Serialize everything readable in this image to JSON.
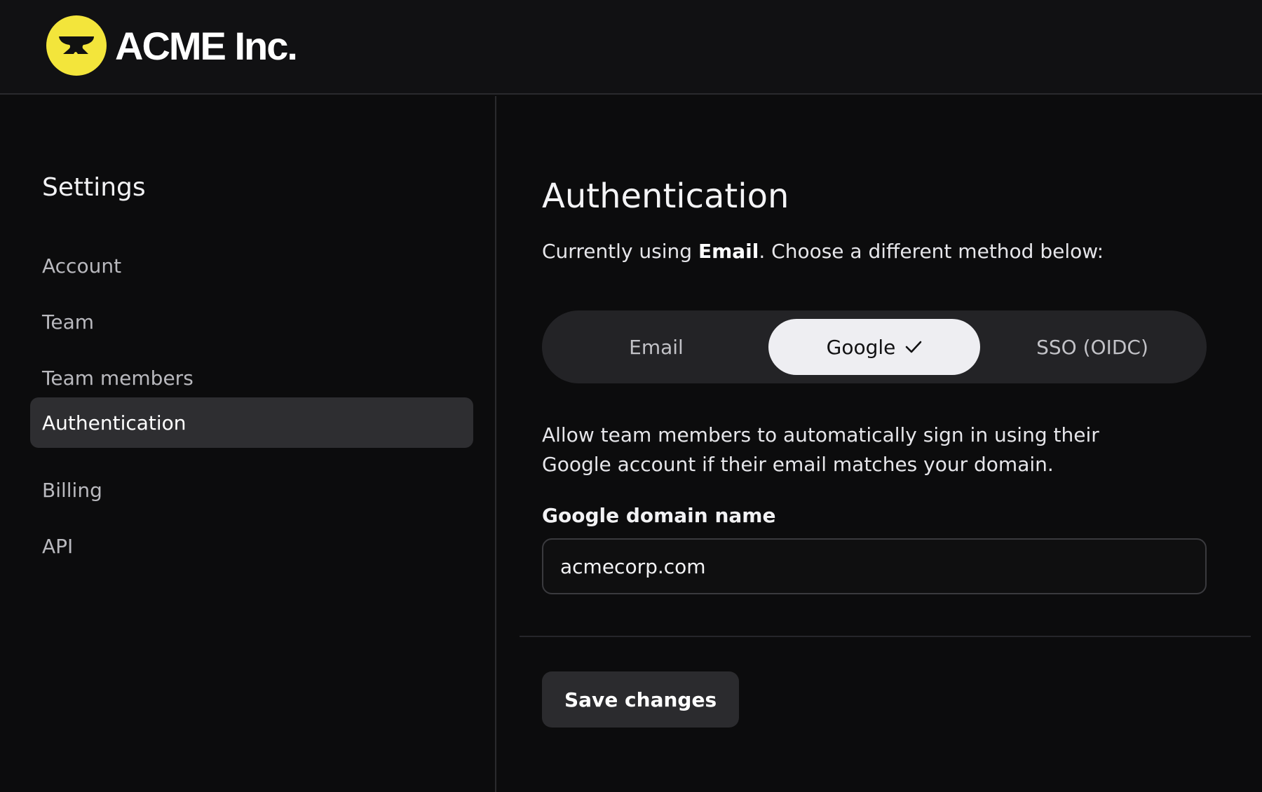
{
  "brand": {
    "name": "ACME Inc.",
    "logo_icon": "anvil-icon",
    "logo_color": "#f3e53b"
  },
  "sidebar": {
    "title": "Settings",
    "items": [
      {
        "label": "Account",
        "active": false
      },
      {
        "label": "Team",
        "active": false
      },
      {
        "label": "Team members",
        "active": false
      },
      {
        "label": "Authentication",
        "active": true
      },
      {
        "label": "Billing",
        "active": false
      },
      {
        "label": "API",
        "active": false
      }
    ]
  },
  "main": {
    "title": "Authentication",
    "current_method": {
      "prefix": "Currently using ",
      "method": "Email",
      "suffix": ". Choose a different method below:"
    },
    "methods": [
      {
        "label": "Email",
        "selected": false
      },
      {
        "label": "Google",
        "selected": true,
        "icon": "checkmark-icon"
      },
      {
        "label": "SSO (OIDC)",
        "selected": false
      }
    ],
    "description": "Allow team members to automatically sign in using their Google account if their email matches your domain.",
    "domain_field": {
      "label": "Google domain name",
      "value": "acmecorp.com"
    },
    "save_label": "Save changes"
  }
}
